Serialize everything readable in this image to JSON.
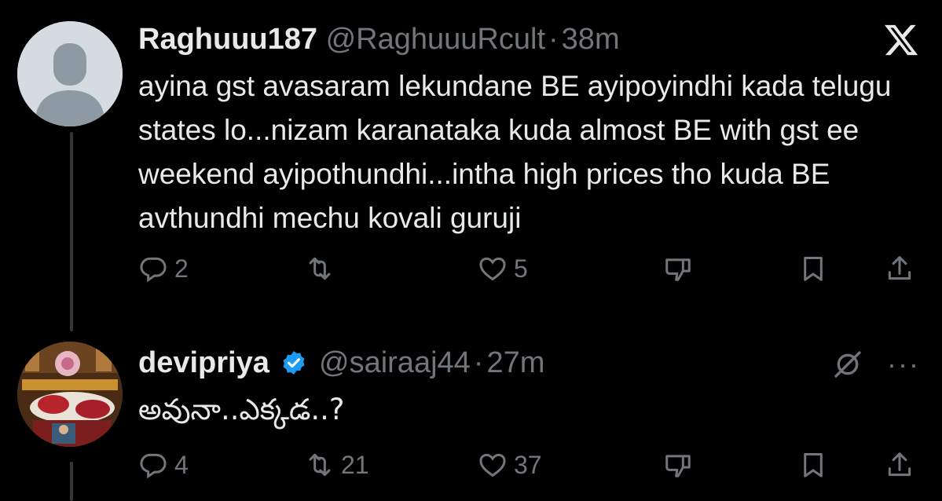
{
  "tweets": [
    {
      "name": "Raghuuu187",
      "handle": "@RaghuuuRcult",
      "time": "38m",
      "text": "ayina gst avasaram lekundane BE ayipoyindhi kada telugu states lo...nizam karanataka kuda almost BE with gst ee weekend ayipothundhi...intha high prices tho kuda BE avthundhi mechu kovali guruji",
      "replies": "2",
      "retweets": "",
      "likes": "5",
      "icons": [
        "reply-icon",
        "retweet-icon",
        "like-icon",
        "dislike-icon",
        "bookmark-icon",
        "share-icon"
      ],
      "top_right_icon": "x-logo-icon"
    },
    {
      "name": "devipriya",
      "handle": "@sairaaj44",
      "time": "27m",
      "text": "అవునా..ఎక్కడ..?",
      "replies": "4",
      "retweets": "21",
      "likes": "37",
      "verified": true,
      "top_right_icons": [
        "grok-icon",
        "more-icon"
      ],
      "more_label": "···"
    }
  ],
  "colors": {
    "background": "#000000",
    "text": "#e7e9ea",
    "muted": "#71767b",
    "verified": "#1d9bf0"
  }
}
